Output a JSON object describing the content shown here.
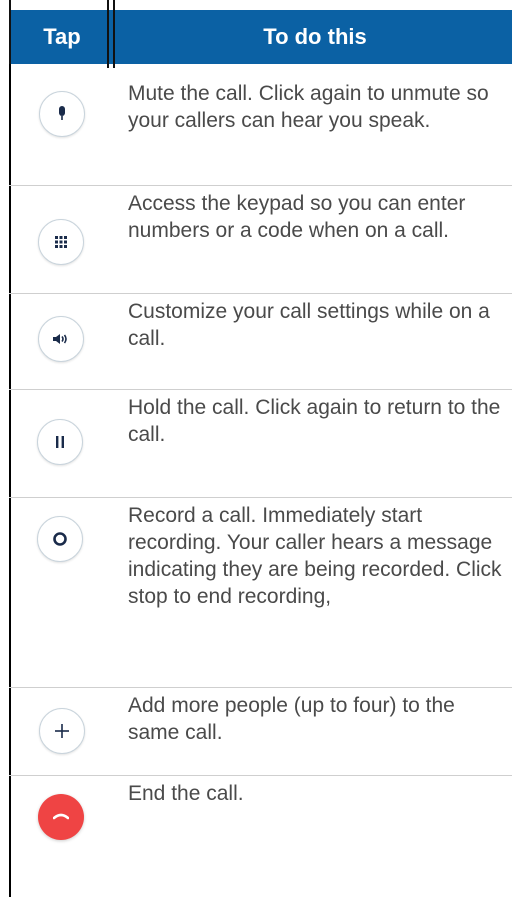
{
  "header": {
    "tap": "Tap",
    "to_do_this": "To do this"
  },
  "rows": [
    {
      "icon": "microphone-icon",
      "text": "Mute the call. Click again to unmute so your callers can hear you speak."
    },
    {
      "icon": "keypad-icon",
      "text": "Access the keypad so you can enter numbers or a code when on a call."
    },
    {
      "icon": "speaker-icon",
      "text": "Customize your call settings while on a call."
    },
    {
      "icon": "pause-icon",
      "text": "Hold the call. Click again to return to the call."
    },
    {
      "icon": "record-icon",
      "text": "Record a call. Immediately start recording. Your caller hears a message indicating they are being recorded. Click stop to end recording,"
    },
    {
      "icon": "plus-icon",
      "text": "Add more people (up to four) to the same call."
    },
    {
      "icon": "end-call-icon",
      "text": "End the call."
    }
  ],
  "colors": {
    "header_bg": "#0b61a4",
    "end_call": "#ef4444",
    "body_text": "#4a4a4a"
  }
}
